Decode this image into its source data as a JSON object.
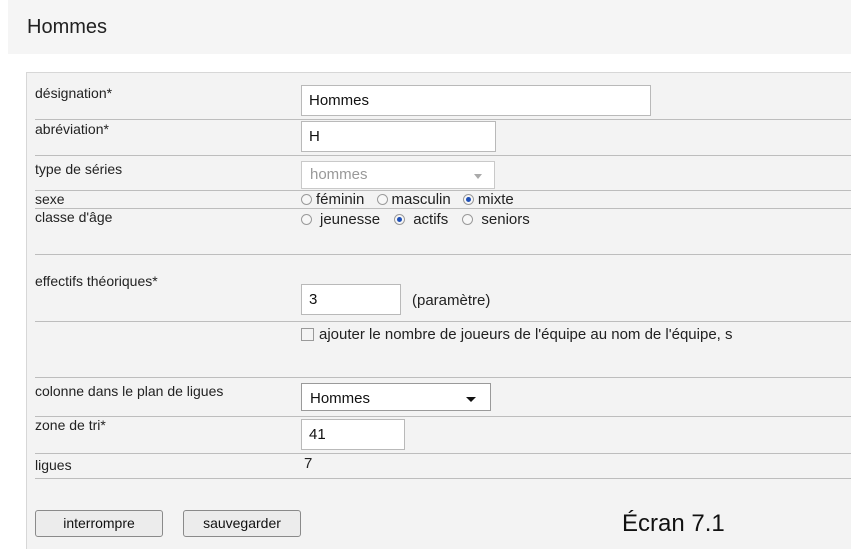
{
  "page": {
    "title": "Hommes"
  },
  "fields": {
    "designation": {
      "label": "désignation*",
      "value": "Hommes"
    },
    "abreviation": {
      "label": "abréviation*",
      "value": "H"
    },
    "type_series": {
      "label": "type de séries",
      "value": "hommes"
    },
    "sexe": {
      "label": "sexe",
      "options": [
        {
          "label": "féminin",
          "checked": false
        },
        {
          "label": "masculin",
          "checked": false
        },
        {
          "label": "mixte",
          "checked": true
        }
      ]
    },
    "classe_age": {
      "label": "classe d'âge",
      "options": [
        {
          "label": "jeunesse",
          "checked": false
        },
        {
          "label": "actifs",
          "checked": true
        },
        {
          "label": "seniors",
          "checked": false
        }
      ]
    },
    "effectifs": {
      "label": "effectifs théoriques*",
      "value": "3",
      "note": "(paramètre)"
    },
    "ajouter": {
      "label": "ajouter le nombre de joueurs de l'équipe au nom de l'équipe, s",
      "checked": false
    },
    "colonne": {
      "label": "colonne dans le plan de ligues",
      "value": "Hommes"
    },
    "zone_tri": {
      "label": "zone de tri*",
      "value": "41"
    },
    "ligues": {
      "label": "ligues",
      "value": "7"
    }
  },
  "buttons": {
    "interrompre": "interrompre",
    "sauvegarder": "sauvegarder"
  },
  "caption": "Écran 7.1",
  "colors": {
    "panel_bg": "#f3f3f3",
    "row_border": "#bdbdbd",
    "radio_dot": "#1e4fb6"
  }
}
